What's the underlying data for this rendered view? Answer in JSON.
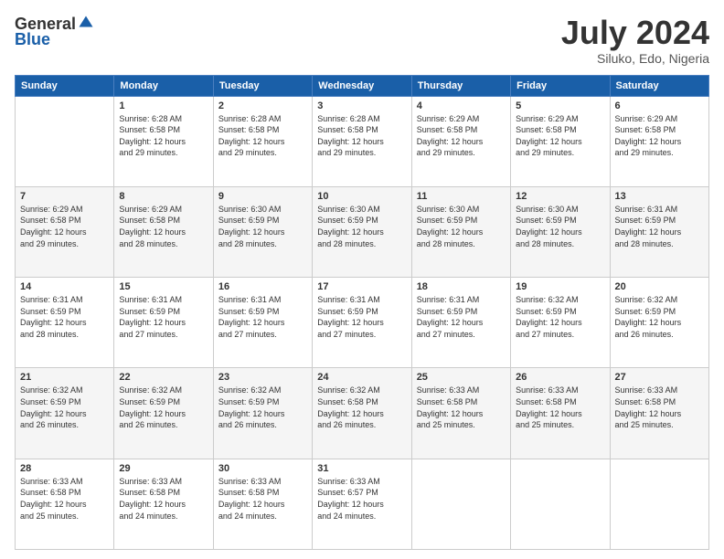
{
  "logo": {
    "general": "General",
    "blue": "Blue"
  },
  "header": {
    "month": "July 2024",
    "location": "Siluko, Edo, Nigeria"
  },
  "days": [
    "Sunday",
    "Monday",
    "Tuesday",
    "Wednesday",
    "Thursday",
    "Friday",
    "Saturday"
  ],
  "weeks": [
    [
      {
        "day": "",
        "info": ""
      },
      {
        "day": "1",
        "info": "Sunrise: 6:28 AM\nSunset: 6:58 PM\nDaylight: 12 hours\nand 29 minutes."
      },
      {
        "day": "2",
        "info": "Sunrise: 6:28 AM\nSunset: 6:58 PM\nDaylight: 12 hours\nand 29 minutes."
      },
      {
        "day": "3",
        "info": "Sunrise: 6:28 AM\nSunset: 6:58 PM\nDaylight: 12 hours\nand 29 minutes."
      },
      {
        "day": "4",
        "info": "Sunrise: 6:29 AM\nSunset: 6:58 PM\nDaylight: 12 hours\nand 29 minutes."
      },
      {
        "day": "5",
        "info": "Sunrise: 6:29 AM\nSunset: 6:58 PM\nDaylight: 12 hours\nand 29 minutes."
      },
      {
        "day": "6",
        "info": "Sunrise: 6:29 AM\nSunset: 6:58 PM\nDaylight: 12 hours\nand 29 minutes."
      }
    ],
    [
      {
        "day": "7",
        "info": "Sunrise: 6:29 AM\nSunset: 6:58 PM\nDaylight: 12 hours\nand 29 minutes."
      },
      {
        "day": "8",
        "info": "Sunrise: 6:29 AM\nSunset: 6:58 PM\nDaylight: 12 hours\nand 28 minutes."
      },
      {
        "day": "9",
        "info": "Sunrise: 6:30 AM\nSunset: 6:59 PM\nDaylight: 12 hours\nand 28 minutes."
      },
      {
        "day": "10",
        "info": "Sunrise: 6:30 AM\nSunset: 6:59 PM\nDaylight: 12 hours\nand 28 minutes."
      },
      {
        "day": "11",
        "info": "Sunrise: 6:30 AM\nSunset: 6:59 PM\nDaylight: 12 hours\nand 28 minutes."
      },
      {
        "day": "12",
        "info": "Sunrise: 6:30 AM\nSunset: 6:59 PM\nDaylight: 12 hours\nand 28 minutes."
      },
      {
        "day": "13",
        "info": "Sunrise: 6:31 AM\nSunset: 6:59 PM\nDaylight: 12 hours\nand 28 minutes."
      }
    ],
    [
      {
        "day": "14",
        "info": "Sunrise: 6:31 AM\nSunset: 6:59 PM\nDaylight: 12 hours\nand 28 minutes."
      },
      {
        "day": "15",
        "info": "Sunrise: 6:31 AM\nSunset: 6:59 PM\nDaylight: 12 hours\nand 27 minutes."
      },
      {
        "day": "16",
        "info": "Sunrise: 6:31 AM\nSunset: 6:59 PM\nDaylight: 12 hours\nand 27 minutes."
      },
      {
        "day": "17",
        "info": "Sunrise: 6:31 AM\nSunset: 6:59 PM\nDaylight: 12 hours\nand 27 minutes."
      },
      {
        "day": "18",
        "info": "Sunrise: 6:31 AM\nSunset: 6:59 PM\nDaylight: 12 hours\nand 27 minutes."
      },
      {
        "day": "19",
        "info": "Sunrise: 6:32 AM\nSunset: 6:59 PM\nDaylight: 12 hours\nand 27 minutes."
      },
      {
        "day": "20",
        "info": "Sunrise: 6:32 AM\nSunset: 6:59 PM\nDaylight: 12 hours\nand 26 minutes."
      }
    ],
    [
      {
        "day": "21",
        "info": "Sunrise: 6:32 AM\nSunset: 6:59 PM\nDaylight: 12 hours\nand 26 minutes."
      },
      {
        "day": "22",
        "info": "Sunrise: 6:32 AM\nSunset: 6:59 PM\nDaylight: 12 hours\nand 26 minutes."
      },
      {
        "day": "23",
        "info": "Sunrise: 6:32 AM\nSunset: 6:59 PM\nDaylight: 12 hours\nand 26 minutes."
      },
      {
        "day": "24",
        "info": "Sunrise: 6:32 AM\nSunset: 6:58 PM\nDaylight: 12 hours\nand 26 minutes."
      },
      {
        "day": "25",
        "info": "Sunrise: 6:33 AM\nSunset: 6:58 PM\nDaylight: 12 hours\nand 25 minutes."
      },
      {
        "day": "26",
        "info": "Sunrise: 6:33 AM\nSunset: 6:58 PM\nDaylight: 12 hours\nand 25 minutes."
      },
      {
        "day": "27",
        "info": "Sunrise: 6:33 AM\nSunset: 6:58 PM\nDaylight: 12 hours\nand 25 minutes."
      }
    ],
    [
      {
        "day": "28",
        "info": "Sunrise: 6:33 AM\nSunset: 6:58 PM\nDaylight: 12 hours\nand 25 minutes."
      },
      {
        "day": "29",
        "info": "Sunrise: 6:33 AM\nSunset: 6:58 PM\nDaylight: 12 hours\nand 24 minutes."
      },
      {
        "day": "30",
        "info": "Sunrise: 6:33 AM\nSunset: 6:58 PM\nDaylight: 12 hours\nand 24 minutes."
      },
      {
        "day": "31",
        "info": "Sunrise: 6:33 AM\nSunset: 6:57 PM\nDaylight: 12 hours\nand 24 minutes."
      },
      {
        "day": "",
        "info": ""
      },
      {
        "day": "",
        "info": ""
      },
      {
        "day": "",
        "info": ""
      }
    ]
  ]
}
